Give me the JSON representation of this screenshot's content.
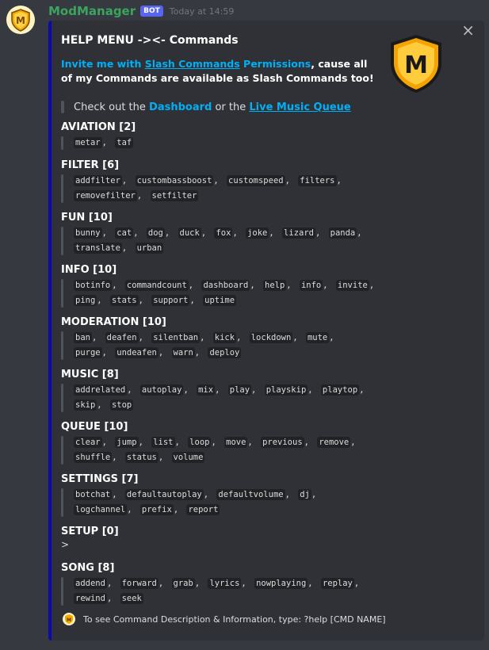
{
  "message": {
    "username": "ModManager",
    "bot_tag": "BOT",
    "timestamp": "Today at 14:59"
  },
  "embed": {
    "accent_color": "#0a0ab0",
    "title": "HELP MENU -><- Commands",
    "desc_invite": "Invite me with",
    "desc_link": "Slash Commands",
    "desc_perm": "Permissions",
    "desc_rest": ", cause all of my Commands are available as Slash Commands too!",
    "quote_prefix": "Check out the",
    "quote_link1": "Dashboard",
    "quote_mid": "or the",
    "quote_link2": "Live Music Queue",
    "close_icon": "×",
    "footer_text": "To see Command Description & Information, type: ?help [CMD NAME]"
  },
  "sections": [
    {
      "title": "AVIATION [2]",
      "commands": [
        "metar",
        "taf"
      ]
    },
    {
      "title": "FILTER [6]",
      "commands": [
        "addfilter",
        "custombassboost",
        "customspeed",
        "filters",
        "removefilter",
        "setfilter"
      ]
    },
    {
      "title": "FUN [10]",
      "commands": [
        "bunny",
        "cat",
        "dog",
        "duck",
        "fox",
        "joke",
        "lizard",
        "panda",
        "translate",
        "urban"
      ]
    },
    {
      "title": "INFO [10]",
      "commands": [
        "botinfo",
        "commandcount",
        "dashboard",
        "help",
        "info",
        "invite",
        "ping",
        "stats",
        "support",
        "uptime"
      ]
    },
    {
      "title": "MODERATION [10]",
      "commands": [
        "ban",
        "deafen",
        "silentban",
        "kick",
        "lockdown",
        "mute",
        "purge",
        "undeafen",
        "warn",
        "deploy"
      ]
    },
    {
      "title": "MUSIC [8]",
      "commands": [
        "addrelated",
        "autoplay",
        "mix",
        "play",
        "playskip",
        "playtop",
        "skip",
        "stop"
      ]
    },
    {
      "title": "QUEUE [10]",
      "commands": [
        "clear",
        "jump",
        "list",
        "loop",
        "move",
        "previous",
        "remove",
        "shuffle",
        "status",
        "volume"
      ]
    },
    {
      "title": "SETTINGS [7]",
      "commands": [
        "botchat",
        "defaultautoplay",
        "defaultvolume",
        "dj",
        "logchannel",
        "prefix",
        "report"
      ]
    },
    {
      "title": "SETUP [0]",
      "commands": [],
      "empty_text": ">"
    },
    {
      "title": "SONG [8]",
      "commands": [
        "addend",
        "forward",
        "grab",
        "lyrics",
        "nowplaying",
        "replay",
        "rewind",
        "seek"
      ]
    }
  ],
  "badge_letter": "M"
}
